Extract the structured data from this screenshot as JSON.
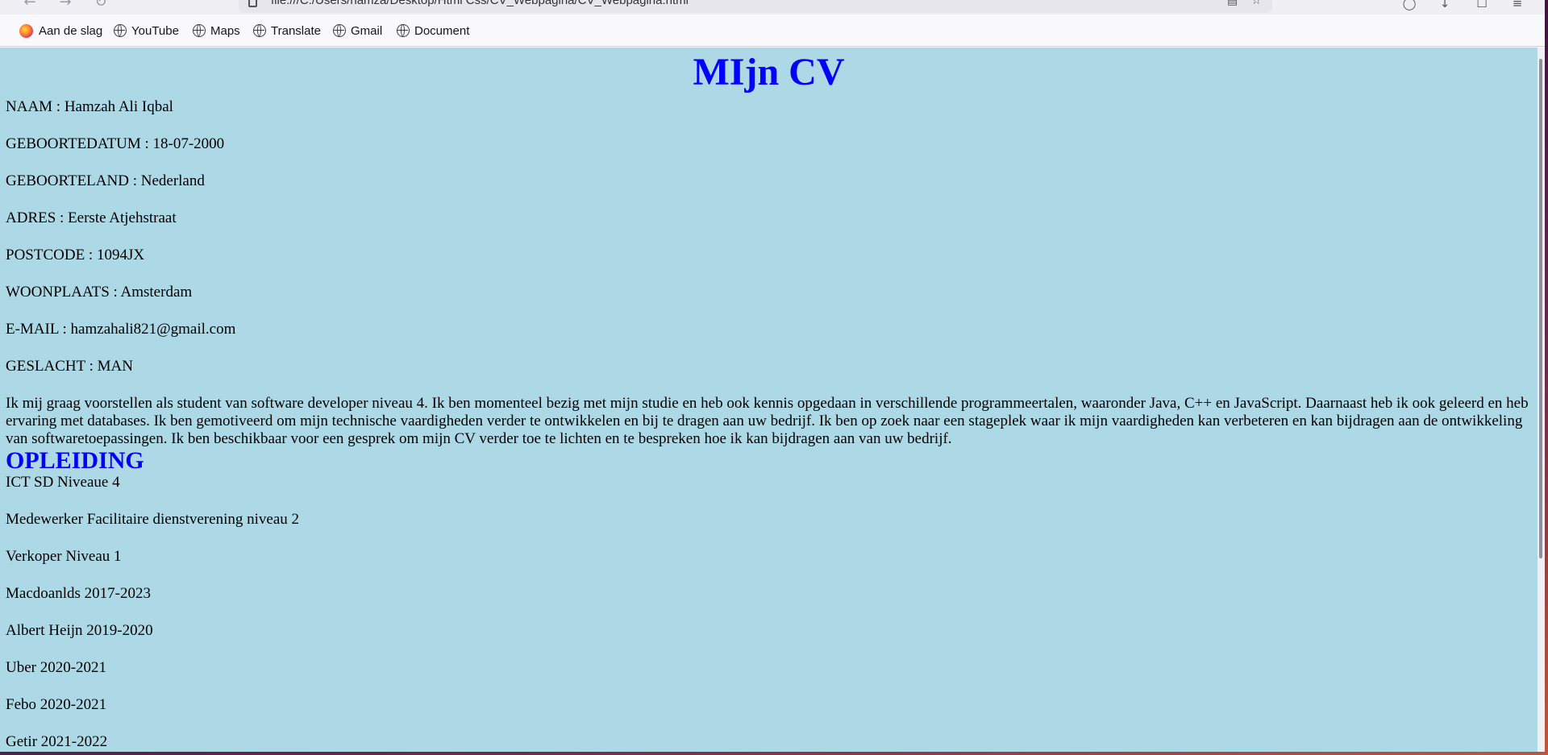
{
  "browser": {
    "url": "file:///C:/Users/hamza/Desktop/Html Css/CV_Webpagina/CV_Webpagina.html",
    "bookmarks": [
      "Aan de slag",
      "YouTube",
      "Maps",
      "Translate",
      "Gmail",
      "Document"
    ]
  },
  "cv": {
    "title": "MIjn CV",
    "personal": [
      "NAAM : Hamzah Ali Iqbal",
      "GEBOORTEDATUM : 18-07-2000",
      "GEBOORTELAND : Nederland",
      "ADRES : Eerste Atjehstraat",
      "POSTCODE : 1094JX",
      "WOONPLAATS : Amsterdam",
      "E-MAIL : hamzahali821@gmail.com",
      "GESLACHT : MAN"
    ],
    "intro": "Ik mij graag voorstellen als student van software developer niveau 4. Ik ben momenteel bezig met mijn studie en heb ook kennis opgedaan in verschillende programmeertalen, waaronder Java, C++ en JavaScript. Daarnaast heb ik ook geleerd en heb ervaring met databases. Ik ben gemotiveerd om mijn technische vaardigheden verder te ontwikkelen en bij te dragen aan uw bedrijf. Ik ben op zoek naar een stageplek waar ik mijn vaardigheden kan verbeteren en kan bijdragen aan de ontwikkeling van softwaretoepassingen. Ik ben beschikbaar voor een gesprek om mijn CV verder toe te lichten en te bespreken hoe ik kan bijdragen aan van uw bedrijf.",
    "education_heading": "OPLEIDING",
    "education": [
      "ICT SD Niveaue 4",
      "Medewerker Facilitaire dienstverening niveau 2",
      "Verkoper Niveau 1",
      "Macdoanlds 2017-2023",
      "Albert Heijn 2019-2020",
      "Uber 2020-2021",
      "Febo 2020-2021",
      "Getir 2021-2022"
    ]
  }
}
